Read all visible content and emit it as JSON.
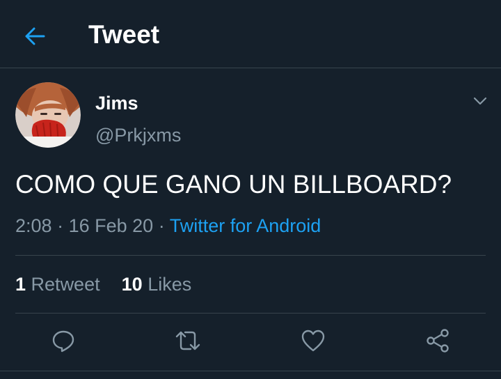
{
  "header": {
    "title": "Tweet",
    "back_icon": "arrow-left-icon"
  },
  "author": {
    "name": "Jims",
    "handle": "@Prkjxms",
    "avatar_icon": "user-avatar"
  },
  "tweet": {
    "text": "COMO QUE GANO UN BILLBOARD?",
    "time": "2:08",
    "sep1": "·",
    "date": "16 Feb 20",
    "sep2": "·",
    "source": "Twitter for Android"
  },
  "stats": {
    "retweets_count": "1",
    "retweets_label": "Retweet",
    "likes_count": "10",
    "likes_label": "Likes"
  },
  "actions": {
    "reply_icon": "reply-icon",
    "retweet_icon": "retweet-icon",
    "like_icon": "heart-icon",
    "share_icon": "share-icon"
  },
  "colors": {
    "background": "#15202b",
    "accent": "#1da1f2",
    "muted_text": "#8899a6",
    "divider": "#38444d"
  }
}
